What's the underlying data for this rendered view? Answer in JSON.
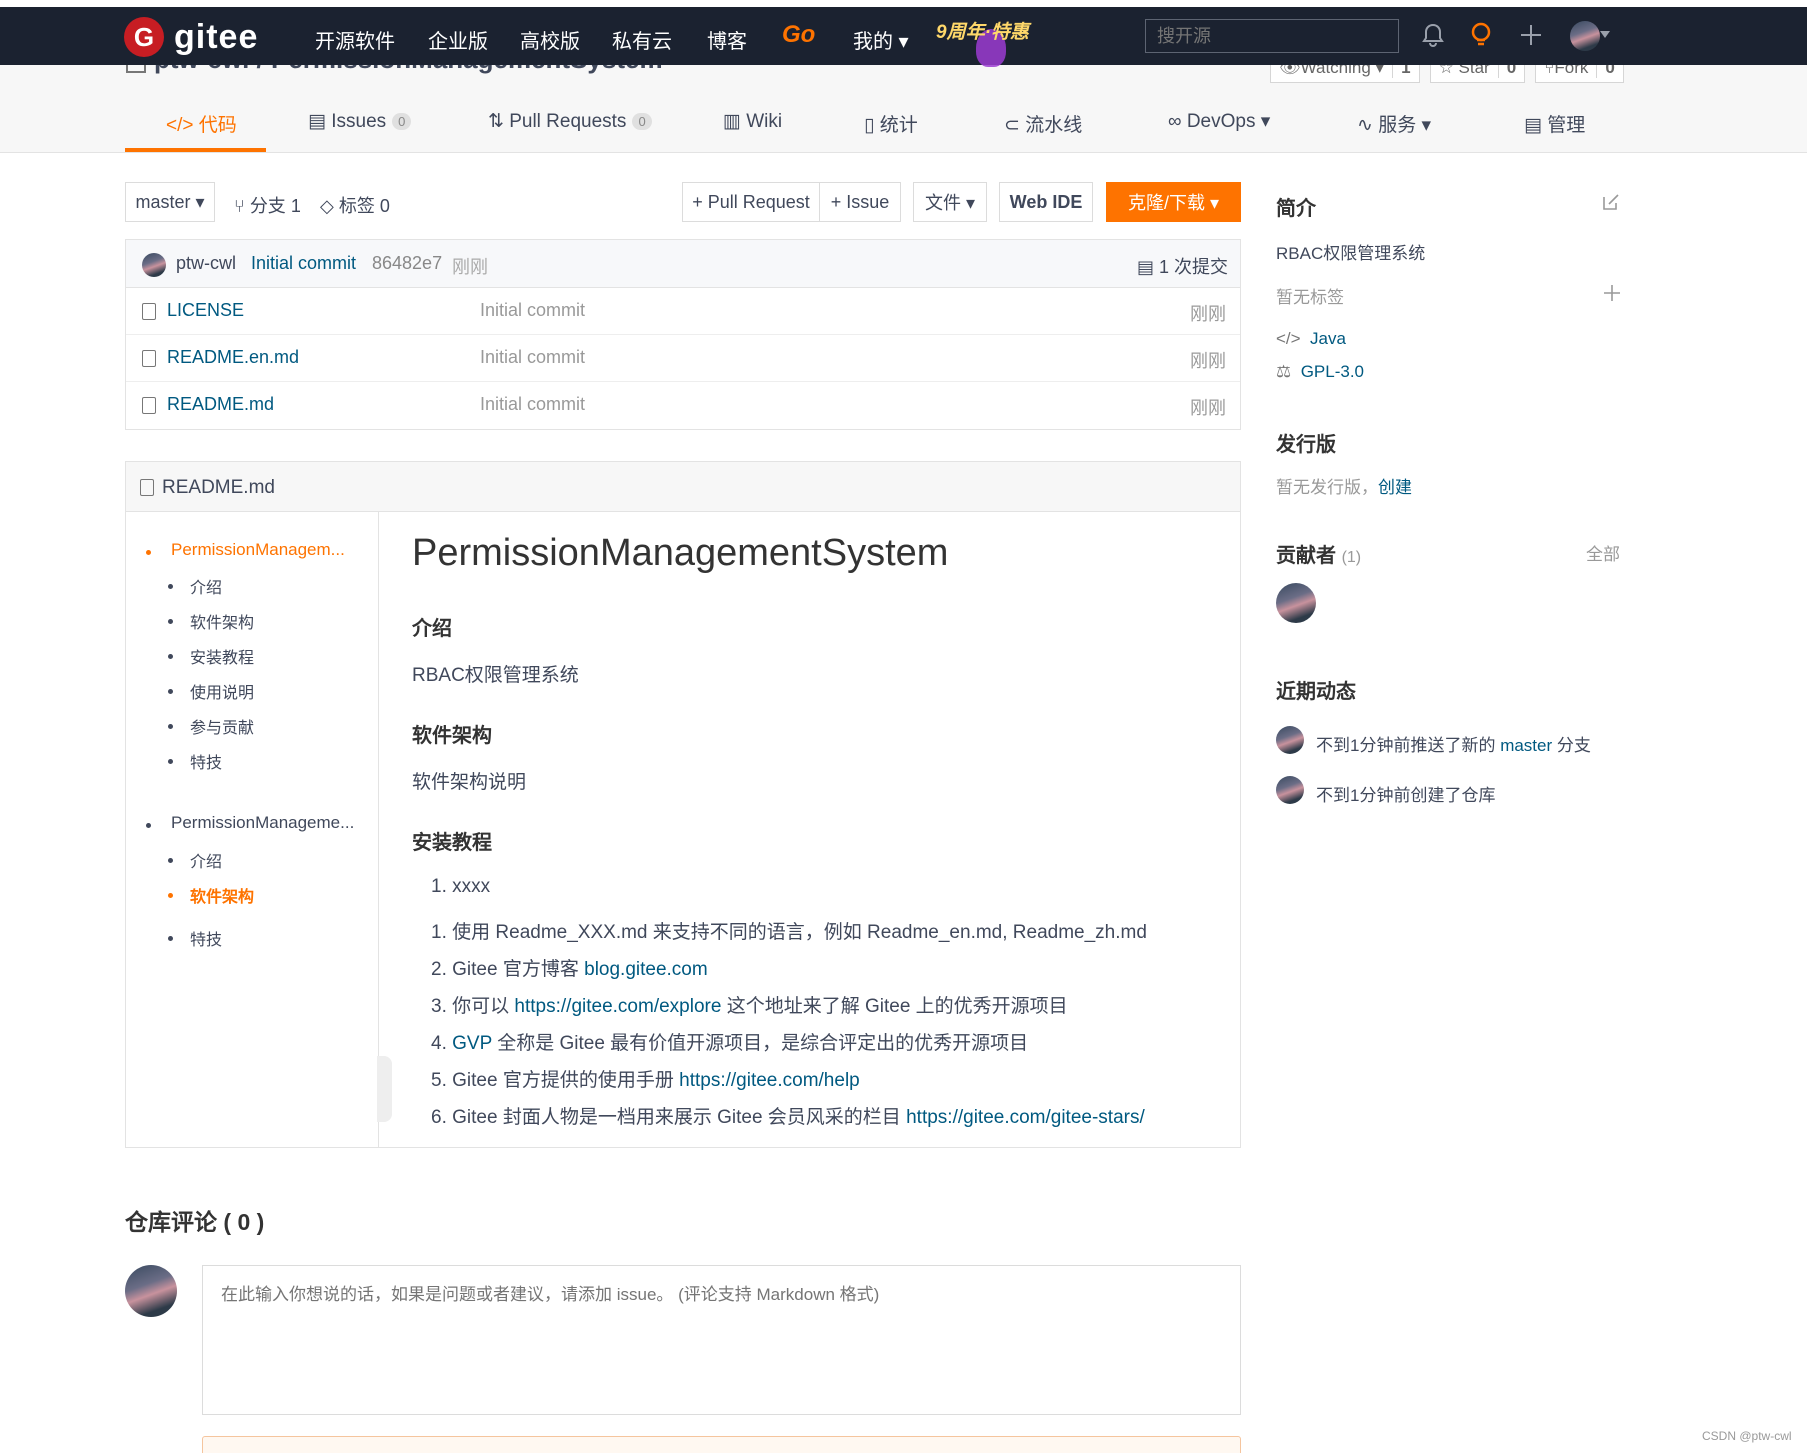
{
  "topbar": {
    "logo_mark": "G",
    "logo_text": "gitee",
    "nav": [
      "开源软件",
      "企业版",
      "高校版",
      "私有云",
      "博客"
    ],
    "go": "Go",
    "mine": "我的 ▾",
    "promo": "9周年·特惠",
    "search_placeholder": "搜开源",
    "icons": [
      "bell-icon",
      "lightbulb-icon",
      "plus-icon",
      "user-avatar"
    ]
  },
  "repo": {
    "path": "ptw-cwl / PermissionManagementSystem",
    "watch_label": "Watching ▾",
    "watch_count": "1",
    "star_label": "☆ Star",
    "star_count": "0",
    "fork_label": "Fork",
    "fork_count": "0"
  },
  "tabs": [
    {
      "label": "</> 代码"
    },
    {
      "label": "Issues",
      "count": "0"
    },
    {
      "label": "Pull Requests",
      "count": "0"
    },
    {
      "label": "Wiki"
    },
    {
      "label": "统计"
    },
    {
      "label": "流水线"
    },
    {
      "label": "DevOps ▾"
    },
    {
      "label": "服务 ▾"
    },
    {
      "label": "管理"
    }
  ],
  "toolbar": {
    "branch": "master ▾",
    "branches": "分支 1",
    "tags": "标签 0",
    "pr_button": "+ Pull Request",
    "issue_button": "+ Issue",
    "file_button": "文件 ▾",
    "webide_button": "Web IDE",
    "clone_button": "克隆/下载 ▾"
  },
  "commit": {
    "author": "ptw-cwl",
    "message": "Initial commit",
    "hash": "86482e7",
    "time": "刚刚",
    "count": "1 次提交"
  },
  "files": [
    {
      "name": "LICENSE",
      "message": "Initial commit",
      "time": "刚刚"
    },
    {
      "name": "README.en.md",
      "message": "Initial commit",
      "time": "刚刚"
    },
    {
      "name": "README.md",
      "message": "Initial commit",
      "time": "刚刚"
    }
  ],
  "readme": {
    "filename": "README.md",
    "toc": [
      {
        "label": "PermissionManagem...",
        "active": true
      },
      {
        "label": "介绍"
      },
      {
        "label": "软件架构"
      },
      {
        "label": "安装教程"
      },
      {
        "label": "使用说明"
      },
      {
        "label": "参与贡献"
      },
      {
        "label": "特技"
      },
      {
        "label": "PermissionManageme..."
      },
      {
        "label": "介绍"
      },
      {
        "label": "软件架构",
        "active": true
      },
      {
        "label": "特技"
      }
    ],
    "title": "PermissionManagementSystem",
    "h_intro": "介绍",
    "intro_text": "RBAC权限管理系统",
    "h_arch": "软件架构",
    "arch_text": "软件架构说明",
    "h_install": "安装教程",
    "install_items": [
      {
        "num": "1.",
        "text": "xxxx"
      },
      {
        "num": "1.",
        "text": "使用 Readme_XXX.md 来支持不同的语言，例如 Readme_en.md, Readme_zh.md"
      },
      {
        "num": "2.",
        "text": "Gitee 官方博客 ",
        "link": "blog.gitee.com"
      },
      {
        "num": "3.",
        "text": "你可以 ",
        "link": "https://gitee.com/explore",
        "after": " 这个地址来了解 Gitee 上的优秀开源项目"
      },
      {
        "num": "4.",
        "link": "GVP",
        "after": " 全称是 Gitee 最有价值开源项目，是综合评定出的优秀开源项目"
      },
      {
        "num": "5.",
        "text": "Gitee 官方提供的使用手册 ",
        "link": "https://gitee.com/help"
      },
      {
        "num": "6.",
        "text": "Gitee 封面人物是一档用来展示 Gitee 会员风采的栏目 ",
        "link": "https://gitee.com/gitee-stars/"
      }
    ]
  },
  "sidebar": {
    "intro_title": "简介",
    "intro_text": "RBAC权限管理系统",
    "no_tags": "暂无标签",
    "lang": "Java",
    "license": "GPL-3.0",
    "release_title": "发行版",
    "release_text": "暂无发行版，",
    "release_link": "创建",
    "contrib_title": "贡献者",
    "contrib_count": "(1)",
    "contrib_all": "全部",
    "activity_title": "近期动态",
    "activity_1_pre": "不到1分钟前推送了新的 ",
    "activity_1_link": "master",
    "activity_1_post": " 分支",
    "activity_2": "不到1分钟前创建了仓库"
  },
  "comments": {
    "title": "仓库评论 ( 0 )",
    "placeholder": "在此输入你想说的话，如果是问题或者建议，请添加 issue。 (评论支持 Markdown 格式)"
  },
  "watermark": "CSDN @ptw-cwl",
  "colors": {
    "accent": "#fe7300",
    "link": "#005980",
    "topbar": "#1b2230"
  }
}
